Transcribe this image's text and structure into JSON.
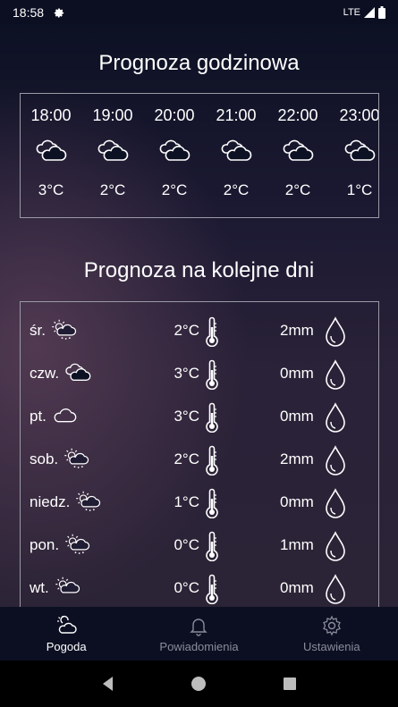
{
  "status_bar": {
    "time": "18:58",
    "network": "LTE"
  },
  "hourly": {
    "title": "Prognoza godzinowa",
    "items": [
      {
        "time": "18:00",
        "icon": "cloudy-icon",
        "temp": "3°C"
      },
      {
        "time": "19:00",
        "icon": "cloudy-icon",
        "temp": "2°C"
      },
      {
        "time": "20:00",
        "icon": "cloudy-icon",
        "temp": "2°C"
      },
      {
        "time": "21:00",
        "icon": "cloudy-icon",
        "temp": "2°C"
      },
      {
        "time": "22:00",
        "icon": "cloudy-icon",
        "temp": "2°C"
      },
      {
        "time": "23:00",
        "icon": "cloudy-icon",
        "temp": "1°C"
      }
    ]
  },
  "daily": {
    "title": "Prognoza na kolejne dni",
    "items": [
      {
        "day": "śr.",
        "icon": "partly-cloudy-snow-icon",
        "temp": "2°C",
        "precip": "2mm"
      },
      {
        "day": "czw.",
        "icon": "cloudy-icon",
        "temp": "3°C",
        "precip": "0mm"
      },
      {
        "day": "pt.",
        "icon": "cloud-icon",
        "temp": "3°C",
        "precip": "0mm"
      },
      {
        "day": "sob.",
        "icon": "partly-cloudy-snow-icon",
        "temp": "2°C",
        "precip": "2mm"
      },
      {
        "day": "niedz.",
        "icon": "partly-cloudy-snow-icon",
        "temp": "1°C",
        "precip": "0mm"
      },
      {
        "day": "pon.",
        "icon": "partly-cloudy-snow-icon",
        "temp": "0°C",
        "precip": "1mm"
      },
      {
        "day": "wt.",
        "icon": "partly-cloudy-icon",
        "temp": "0°C",
        "precip": "0mm"
      }
    ]
  },
  "bottom_nav": {
    "items": [
      {
        "label": "Pogoda",
        "icon": "weather-icon",
        "active": true
      },
      {
        "label": "Powiadomienia",
        "icon": "bell-icon",
        "active": false
      },
      {
        "label": "Ustawienia",
        "icon": "gear-icon",
        "active": false
      }
    ]
  },
  "colors": {
    "background_top": "#0d1124",
    "background_accent": "#583e56",
    "nav_bg": "#0c0f22",
    "inactive": "#8a8c9a"
  }
}
